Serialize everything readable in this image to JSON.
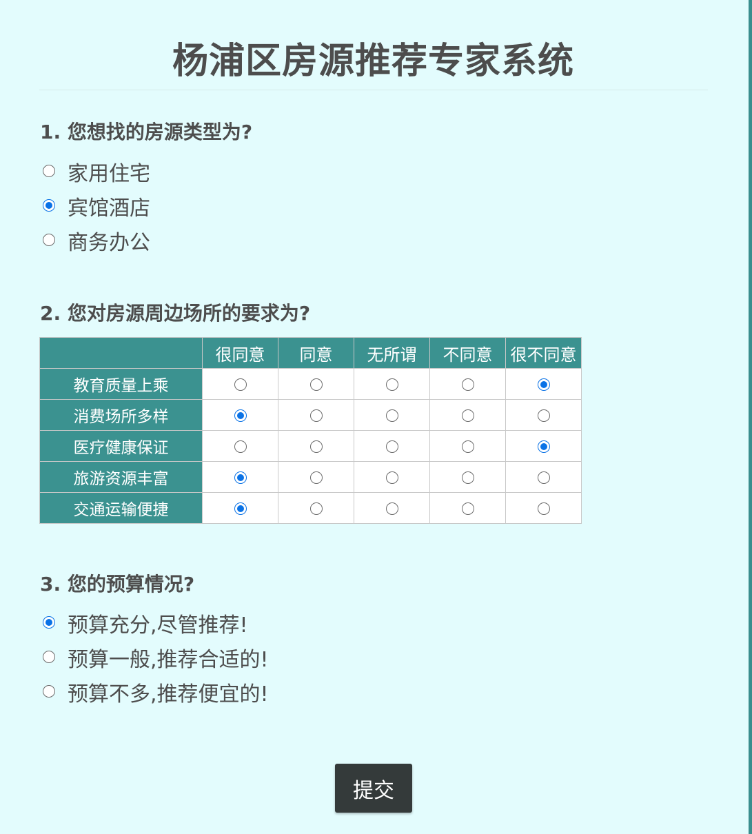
{
  "page": {
    "title": "杨浦区房源推荐专家系统"
  },
  "question1": {
    "title": "1. 您想找的房源类型为?",
    "options": [
      {
        "label": "家用住宅",
        "selected": false
      },
      {
        "label": "宾馆酒店",
        "selected": true
      },
      {
        "label": "商务办公",
        "selected": false
      }
    ]
  },
  "question2": {
    "title": "2. 您对房源周边场所的要求为?",
    "columns": [
      "很同意",
      "同意",
      "无所谓",
      "不同意",
      "很不同意"
    ],
    "rows": [
      {
        "label": "教育质量上乘",
        "selected_index": 4
      },
      {
        "label": "消费场所多样",
        "selected_index": 0
      },
      {
        "label": "医疗健康保证",
        "selected_index": 4
      },
      {
        "label": "旅游资源丰富",
        "selected_index": 0
      },
      {
        "label": "交通运输便捷",
        "selected_index": 0
      }
    ]
  },
  "question3": {
    "title": "3. 您的预算情况?",
    "options": [
      {
        "label": "预算充分,尽管推荐!",
        "selected": true
      },
      {
        "label": "预算一般,推荐合适的!",
        "selected": false
      },
      {
        "label": "预算不多,推荐便宜的!",
        "selected": false
      }
    ]
  },
  "submit": {
    "label": "提交"
  },
  "colors": {
    "background": "#e3fcfd",
    "header_teal": "#3b9290",
    "radio_checked": "#0a72e6",
    "button_dark": "#343a3a"
  }
}
